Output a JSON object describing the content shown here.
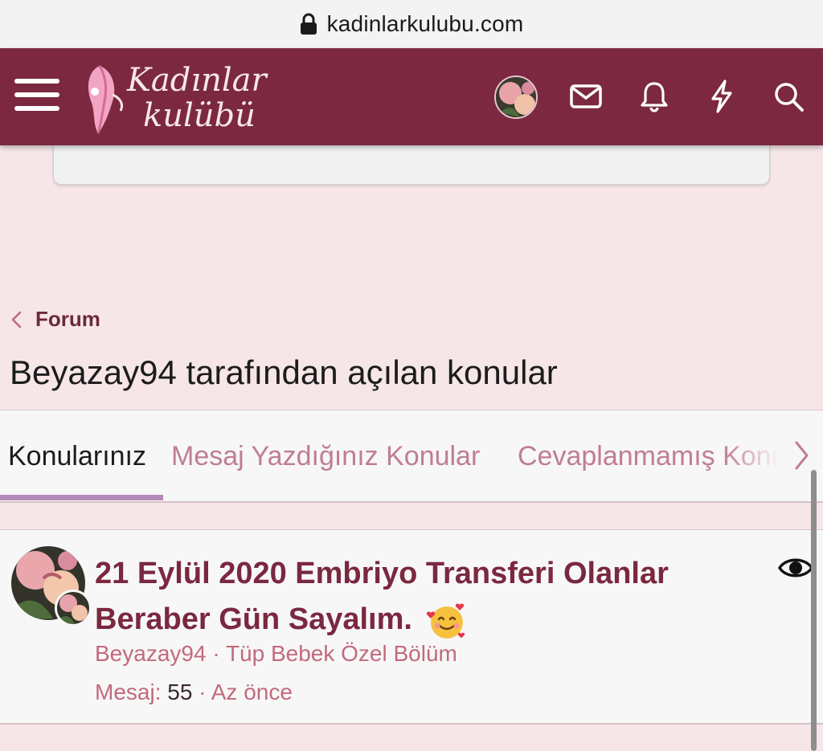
{
  "browser": {
    "url": "kadinlarkulubu.com"
  },
  "header": {
    "logo_line1": "Kadınlar",
    "logo_line2": "kulübü",
    "colors": {
      "bar": "#7b2840",
      "icon": "#ffffff"
    }
  },
  "breadcrumb": {
    "label": "Forum"
  },
  "page": {
    "title": "Beyazay94 tarafından açılan konular"
  },
  "tabs": [
    {
      "label": "Konularınız",
      "active": true
    },
    {
      "label": "Mesaj Yazdığınız Konular",
      "active": false
    },
    {
      "label": "Cevaplanmamış Konular",
      "active": false
    }
  ],
  "thread": {
    "title": "21 Eylül 2020 Embriyo Transferi Olanlar Beraber Gün Sayalım.",
    "author": "Beyazay94",
    "separator": " · ",
    "forum": "Tüp Bebek Özel Bölüm",
    "replies_label": "Mesaj:",
    "replies": "55",
    "time": "Az önce"
  },
  "colors": {
    "accent": "#7b2840",
    "link": "#c26a7d",
    "tab_inactive": "#c07e92",
    "tab_underline": "#b68ab8",
    "page_bg": "#f6e6e8"
  }
}
